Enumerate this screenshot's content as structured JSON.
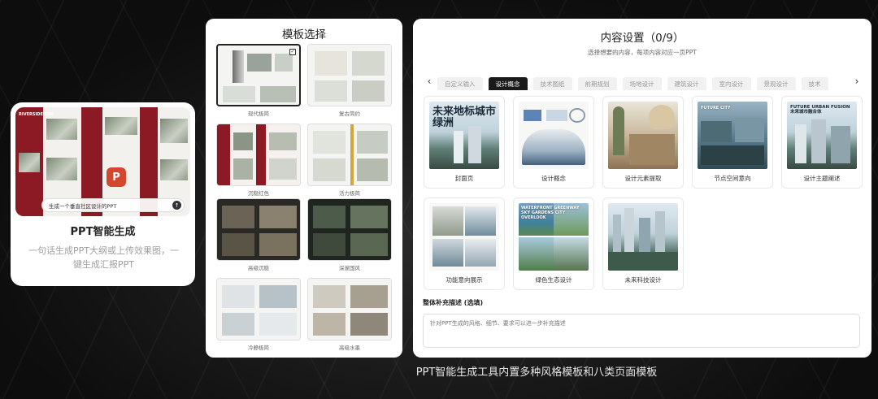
{
  "left_card": {
    "title": "PPT智能生成",
    "description": "一句话生成PPT大纲或上传效果图，一键生成汇报PPT",
    "thumb_heading": "RIVERSIDE ONE",
    "prompt_text": "生成一个垂直社区设计的PPT",
    "send_icon": "arrow-up-icon",
    "logo_letter": "P"
  },
  "template_panel": {
    "title": "模板选择",
    "templates": [
      {
        "label": "现代极简",
        "selected": true
      },
      {
        "label": "复古简约",
        "selected": false
      },
      {
        "label": "沉稳红色",
        "selected": false
      },
      {
        "label": "活力极简",
        "selected": false
      },
      {
        "label": "高级沉稳",
        "selected": false
      },
      {
        "label": "深邃国风",
        "selected": false
      },
      {
        "label": "冷静极简",
        "selected": false
      },
      {
        "label": "高级水墨",
        "selected": false
      }
    ]
  },
  "content_panel": {
    "title": "内容设置（0/9）",
    "subtitle": "选择想要的内容，每项内容对应一页PPT",
    "tabs": [
      "自定义输入",
      "设计概念",
      "技术图纸",
      "前期规划",
      "场地设计",
      "建筑设计",
      "室内设计",
      "景观设计",
      "技术"
    ],
    "active_tab": "设计概念",
    "cards": [
      {
        "label": "封面页",
        "overlay": "未来地标城市绿洲"
      },
      {
        "label": "设计概念",
        "overlay": ""
      },
      {
        "label": "设计元素提取",
        "overlay": ""
      },
      {
        "label": "节点空间意向",
        "overlay": "FUTURE CITY"
      },
      {
        "label": "设计主题阐述",
        "overlay": "FUTURE URBAN FUSION 未来城市融合体"
      },
      {
        "label": "功能意向展示",
        "overlay": ""
      },
      {
        "label": "绿色生态设计",
        "overlay": "WATERFRONT GREENWAY SKY GARDENS CITY OVERLOOK"
      },
      {
        "label": "未来科技设计",
        "overlay": ""
      }
    ],
    "desc_label": "整体补充描述 (选填)",
    "desc_placeholder": "针对PPT生成的风格、细节、要求可以进一步补充描述"
  },
  "caption": "PPT智能生成工具内置多种风格模板和八类页面模板",
  "colors": {
    "accent_dark": "#1a1a1a",
    "template_red": "#8c1a24",
    "ppt_orange": "#d4472f"
  }
}
